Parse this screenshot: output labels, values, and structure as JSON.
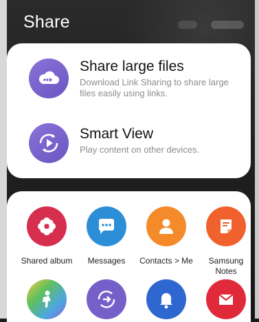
{
  "header": {
    "title": "Share"
  },
  "top_options": [
    {
      "title": "Share large files",
      "subtitle": "Download Link Sharing to share large files easily using links.",
      "icon": "cloud-link-icon"
    },
    {
      "title": "Smart View",
      "subtitle": "Play content on other devices.",
      "icon": "smart-view-icon"
    }
  ],
  "apps": [
    {
      "label": "Shared album",
      "icon": "flower-icon",
      "color": "#d62e4f"
    },
    {
      "label": "Messages",
      "icon": "chat-bubble-icon",
      "color": "#2d8ed8"
    },
    {
      "label": "Contacts > Me",
      "icon": "person-icon",
      "color": "#f58a2b"
    },
    {
      "label": "Samsung Notes",
      "icon": "note-icon",
      "color": "#f0612e"
    },
    {
      "label": "",
      "icon": "figure-icon",
      "color": "#4da7e0"
    },
    {
      "label": "",
      "icon": "smart-view-icon",
      "color": "#7560c9"
    },
    {
      "label": "",
      "icon": "bell-icon",
      "color": "#2f67d0"
    },
    {
      "label": "",
      "icon": "mail-icon",
      "color": "#e02a3a"
    }
  ]
}
